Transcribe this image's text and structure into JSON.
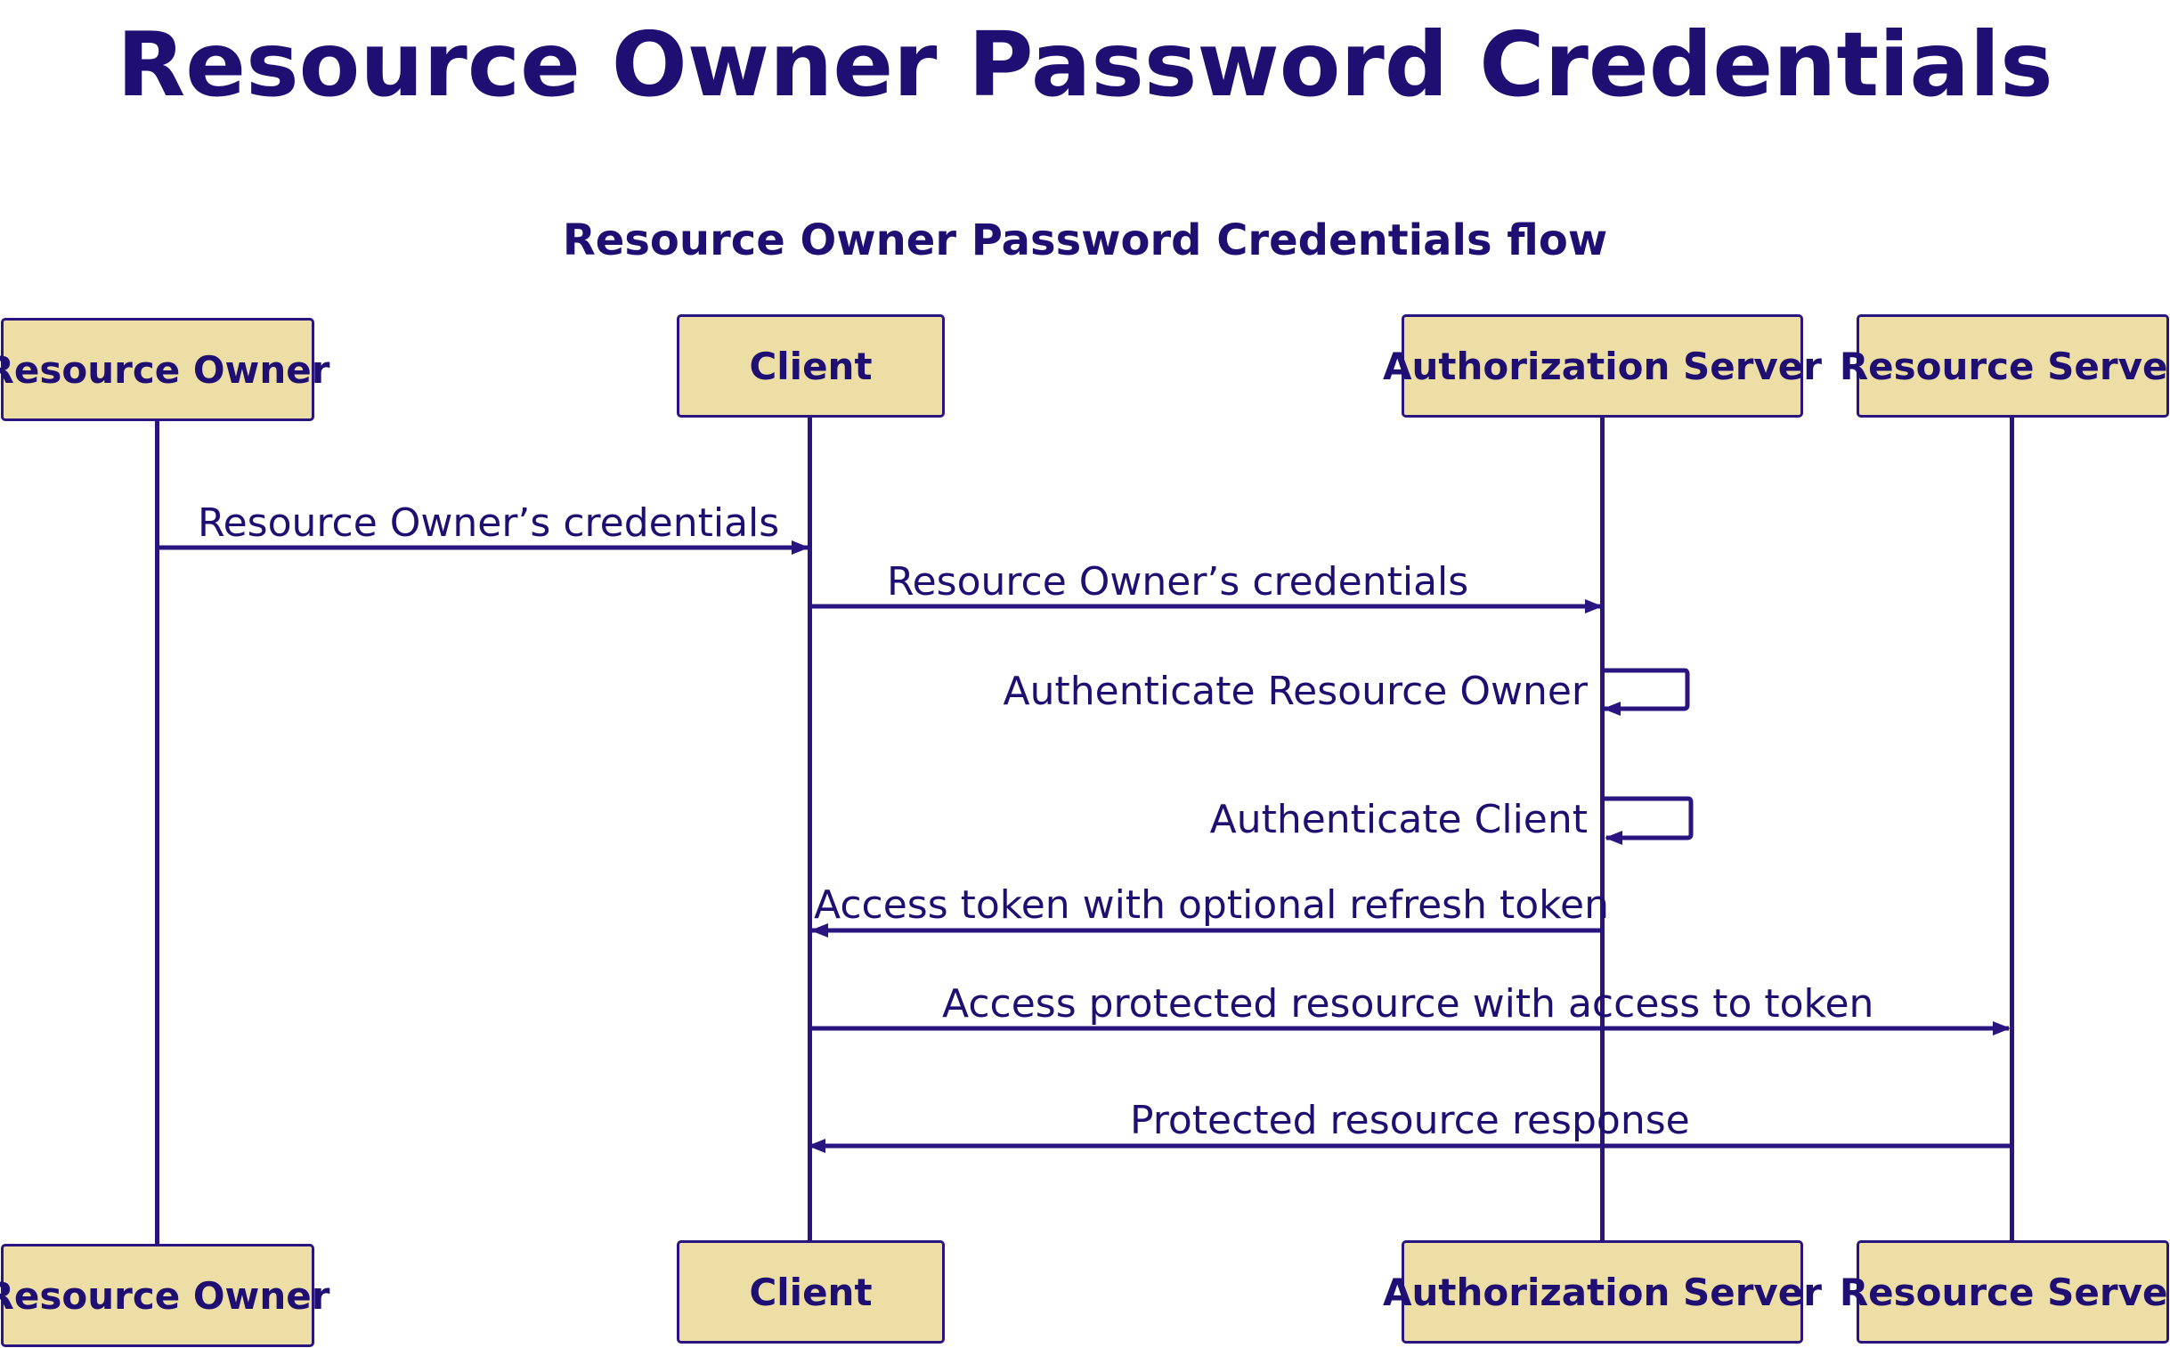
{
  "title": "Resource Owner Password Credentials",
  "subtitle": "Resource Owner Password Credentials flow",
  "participants": [
    {
      "id": "resource-owner",
      "label": "Resource Owner"
    },
    {
      "id": "client",
      "label": "Client"
    },
    {
      "id": "authorization-server",
      "label": "Authorization Server"
    },
    {
      "id": "resource-server",
      "label": "Resource Server"
    }
  ],
  "messages": [
    {
      "from": "resource-owner",
      "to": "client",
      "label": "Resource Owner’s credentials"
    },
    {
      "from": "client",
      "to": "authorization-server",
      "label": "Resource Owner’s credentials"
    },
    {
      "from": "authorization-server",
      "to": "authorization-server",
      "label": "Authenticate Resource Owner"
    },
    {
      "from": "authorization-server",
      "to": "authorization-server",
      "label": "Authenticate Client"
    },
    {
      "from": "authorization-server",
      "to": "client",
      "label": "Access token with optional refresh token"
    },
    {
      "from": "client",
      "to": "resource-server",
      "label": "Access protected resource with access to token"
    },
    {
      "from": "resource-server",
      "to": "client",
      "label": "Protected resource response"
    }
  ],
  "colors": {
    "line": "#2a1480",
    "box_fill": "#ecdea4",
    "text": "#1f0f73"
  }
}
